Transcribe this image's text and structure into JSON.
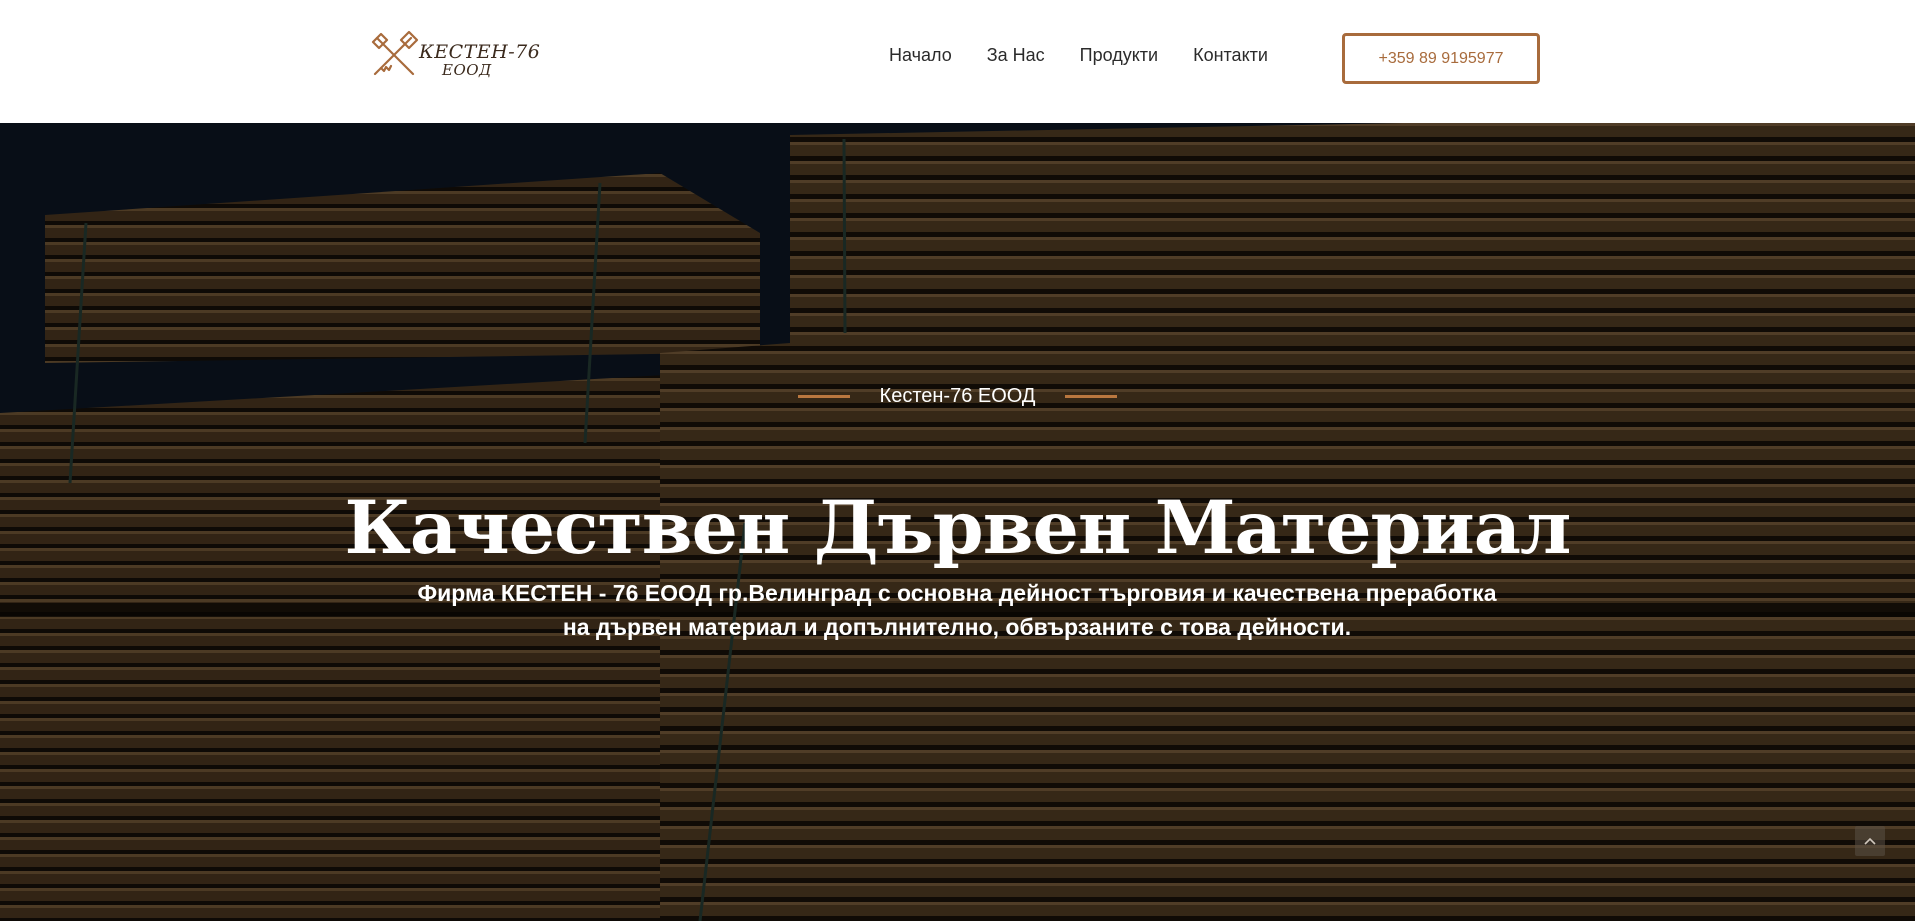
{
  "logo": {
    "line1": "КЕСТЕН-76",
    "line2": "ЕООД",
    "icon": "crossed-axes-logo-icon"
  },
  "nav": {
    "items": [
      {
        "label": "Начало"
      },
      {
        "label": "За Нас"
      },
      {
        "label": "Продукти"
      },
      {
        "label": "Контакти"
      }
    ]
  },
  "phone": {
    "label": "+359 89 9195977"
  },
  "hero": {
    "eyebrow": "Кестен-76 ЕООД",
    "title": "Качествен Дървен Материал",
    "description": "Фирма КЕСТЕН - 76 ЕООД гр.Велинград с основна дейност търговия и качествена преработка на дървен материал и допълнително, обвързаните с това дейности.",
    "background": "stacked-lumber-photo"
  },
  "scroll_top": {
    "icon": "chevron-up-icon"
  },
  "colors": {
    "accent": "#a86b3c",
    "eyebrow_line": "#b9773f",
    "sky": "#0f1a2a",
    "wood_dark": "#2b2014"
  }
}
